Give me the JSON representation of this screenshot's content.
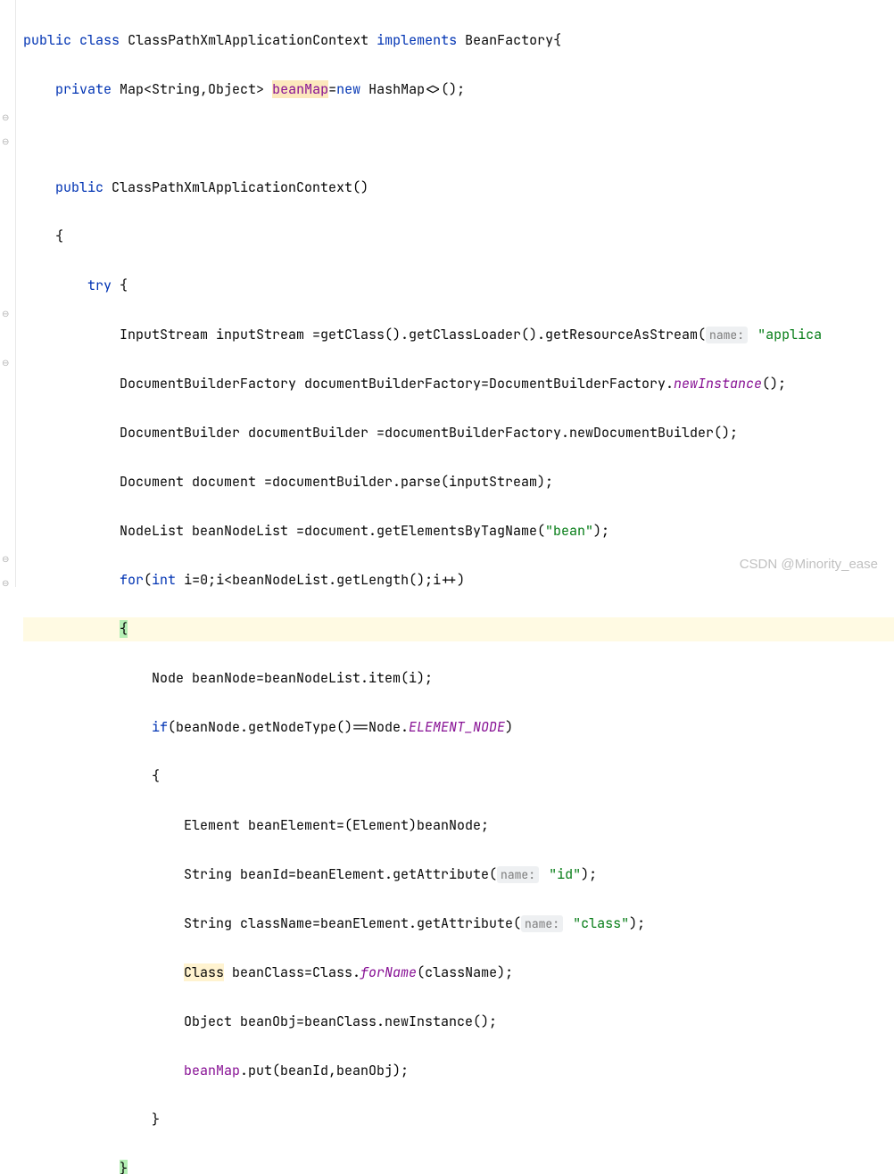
{
  "code": {
    "l1": {
      "kw1": "public",
      "kw2": "class",
      "cls": "ClassPathXmlApplicationContext",
      "kw3": "implements",
      "iface": "BeanFactory",
      "br": "{"
    },
    "l2": {
      "kw1": "private",
      "type": "Map<String,Object>",
      "field": "beanMap",
      "eq": "=",
      "kw2": "new",
      "ctor": "HashMap<>();"
    },
    "l3": {
      "kw1": "public",
      "ctor": "ClassPathXmlApplicationContext",
      "paren": "()"
    },
    "l4": {
      "br": "{"
    },
    "l5": {
      "kw": "try",
      "br": "{"
    },
    "l6": {
      "a": "InputStream inputStream =getClass().getClassLoader().getResourceAsStream(",
      "hint": "name:",
      "str": "\"applica"
    },
    "l7": {
      "a": "DocumentBuilderFactory documentBuilderFactory=DocumentBuilderFactory.",
      "m": "newInstance",
      "b": "();"
    },
    "l8": {
      "a": "DocumentBuilder documentBuilder =documentBuilderFactory.newDocumentBuilder();"
    },
    "l9": {
      "a": "Document document =documentBuilder.parse(inputStream);"
    },
    "l10": {
      "a": "NodeList beanNodeList =document.getElementsByTagName(",
      "str": "\"bean\"",
      "b": ");"
    },
    "l11": {
      "kw": "for",
      "a": "(",
      "kw2": "int",
      "b": " i=",
      "n": "0",
      "c": ";i<beanNodeList.getLength();i++)"
    },
    "l12": {
      "br": "{"
    },
    "l13": {
      "a": "Node beanNode=beanNodeList.item(i);"
    },
    "l14": {
      "kw": "if",
      "a": "(beanNode.getNodeType()==Node.",
      "c": "ELEMENT_NODE",
      "b": ")"
    },
    "l15": {
      "br": "{"
    },
    "l16": {
      "a": "Element beanElement=(Element)beanNode;"
    },
    "l17": {
      "a": "String beanId=beanElement.getAttribute(",
      "hint": "name:",
      "str": "\"id\"",
      "b": ");"
    },
    "l18": {
      "a": "String className=beanElement.getAttribute(",
      "hint": "name:",
      "str": "\"class\"",
      "b": ");"
    },
    "l19": {
      "warn": "Class",
      "a": " beanClass=Class.",
      "m": "forName",
      "b": "(className);"
    },
    "l20": {
      "a": "Object beanObj=beanClass.newInstance();"
    },
    "l21": {
      "field": "beanMap",
      "a": ".put(beanId,beanObj);"
    },
    "l22": {
      "br": "}"
    },
    "l23": {
      "br": "}"
    }
  },
  "watermark": "CSDN @Minority_ease"
}
